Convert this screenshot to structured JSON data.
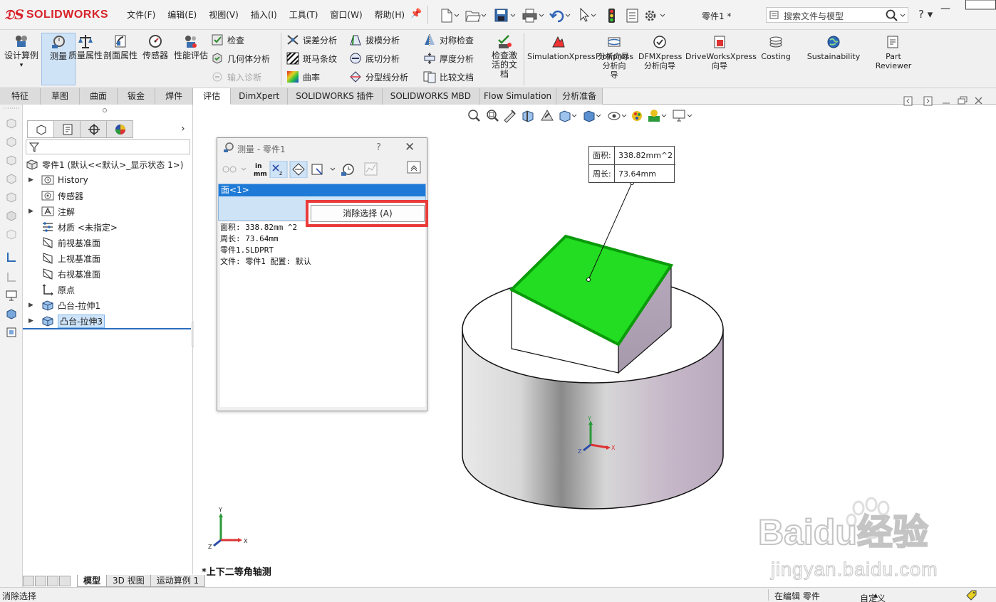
{
  "app": {
    "brand": "SOLIDWORKS",
    "doc_title": "零件1 *",
    "search_placeholder": "搜索文件与模型",
    "help_label": "?"
  },
  "menu": [
    "文件(F)",
    "编辑(E)",
    "视图(V)",
    "插入(I)",
    "工具(T)",
    "窗口(W)",
    "帮助(H)"
  ],
  "command_manager": {
    "big_buttons": [
      {
        "id": "design-study",
        "label": "设计算例",
        "icon": "design-study-icon"
      },
      {
        "id": "measure",
        "label": "测量",
        "icon": "measure-icon",
        "active": true
      },
      {
        "id": "mass-properties",
        "label": "质量属性",
        "icon": "scale-icon"
      },
      {
        "id": "section-properties",
        "label": "剖面属性",
        "icon": "section-icon"
      },
      {
        "id": "sensor",
        "label": "传感器",
        "icon": "sensor-icon"
      },
      {
        "id": "performance-evaluation",
        "label": "性能评估",
        "icon": "performance-icon"
      }
    ],
    "small_buttons_col1": [
      {
        "label": "检查",
        "icon": "check-icon"
      },
      {
        "label": "几何体分析",
        "icon": "geometry-analysis-icon"
      },
      {
        "label": "输入诊断",
        "icon": "import-diagnostics-icon",
        "disabled": true
      }
    ],
    "small_buttons_col2": [
      {
        "label": "误差分析",
        "icon": "deviation-icon"
      },
      {
        "label": "斑马条纹",
        "icon": "zebra-icon"
      },
      {
        "label": "曲率",
        "icon": "curvature-icon"
      }
    ],
    "small_buttons_col3": [
      {
        "label": "拔模分析",
        "icon": "draft-analysis-icon"
      },
      {
        "label": "底切分析",
        "icon": "undercut-icon"
      },
      {
        "label": "分型线分析",
        "icon": "parting-line-icon"
      }
    ],
    "small_buttons_col4": [
      {
        "label": "对称检查",
        "icon": "symmetry-icon"
      },
      {
        "label": "厚度分析",
        "icon": "thickness-icon"
      },
      {
        "label": "比较文档",
        "icon": "compare-docs-icon"
      }
    ],
    "check_active_doc": "检查激活的文档",
    "wizards": [
      {
        "label": "SimulationXpress\n分析向导",
        "icon": "simulationxpress-icon"
      },
      {
        "label": "FloXpress\n分析向\n导",
        "icon": "floxpress-icon"
      },
      {
        "label": "DFMXpress\n分析向导",
        "icon": "dfmxpress-icon"
      },
      {
        "label": "DriveWorksXpress\n向导",
        "icon": "driveworks-icon"
      },
      {
        "label": "Costing",
        "icon": "costing-icon"
      },
      {
        "label": "Sustainability",
        "icon": "sustainability-icon"
      },
      {
        "label": "Part\nReviewer",
        "icon": "part-reviewer-icon"
      }
    ]
  },
  "tabs": [
    "特征",
    "草图",
    "曲面",
    "钣金",
    "焊件",
    "评估",
    "DimXpert",
    "SOLIDWORKS 插件",
    "SOLIDWORKS MBD",
    "Flow Simulation",
    "分析准备"
  ],
  "active_tab": "评估",
  "feature_tree": {
    "root": "零件1  (默认<<默认>_显示状态 1>)",
    "items": [
      {
        "label": "History",
        "icon": "history-icon",
        "expandable": true
      },
      {
        "label": "传感器",
        "icon": "sensor-folder-icon",
        "expandable": false
      },
      {
        "label": "注解",
        "icon": "annotation-icon",
        "expandable": true
      },
      {
        "label": "材质 <未指定>",
        "icon": "material-icon",
        "expandable": false
      },
      {
        "label": "前视基准面",
        "icon": "plane-icon",
        "expandable": false
      },
      {
        "label": "上视基准面",
        "icon": "plane-icon",
        "expandable": false
      },
      {
        "label": "右视基准面",
        "icon": "plane-icon",
        "expandable": false
      },
      {
        "label": "原点",
        "icon": "origin-icon",
        "expandable": false
      },
      {
        "label": "凸台-拉伸1",
        "icon": "extrude-icon",
        "expandable": true
      },
      {
        "label": "凸台-拉伸3",
        "icon": "extrude-icon",
        "expandable": true,
        "selected": true
      }
    ]
  },
  "measure_dialog": {
    "title": "测量 - 零件1",
    "help": "?",
    "units_label_top": "in",
    "units_label_bottom": "mm",
    "selection": "面<1>",
    "context_button": "消除选择 (A)",
    "results": [
      "面积: 338.82mm ^2",
      "周长: 73.64mm",
      "零件1.SLDPRT",
      "文件: 零件1 配置: 默认"
    ]
  },
  "callout": {
    "area_label": "面积:",
    "area_value": "338.82mm^2",
    "perimeter_label": "周长:",
    "perimeter_value": "73.64mm"
  },
  "graphics": {
    "view_name": "*上下二等角轴测",
    "face_highlight_color": "#22dd22",
    "triad_axes": [
      "X",
      "Y",
      "Z"
    ]
  },
  "bottom_tabs": [
    "模型",
    "3D 视图",
    "运动算例 1"
  ],
  "status_bar": {
    "left": "消除选择",
    "mode": "在编辑 零件",
    "units": "自定义"
  },
  "watermark": {
    "brand": "Baidu经验",
    "url": "jingyan.baidu.com"
  }
}
